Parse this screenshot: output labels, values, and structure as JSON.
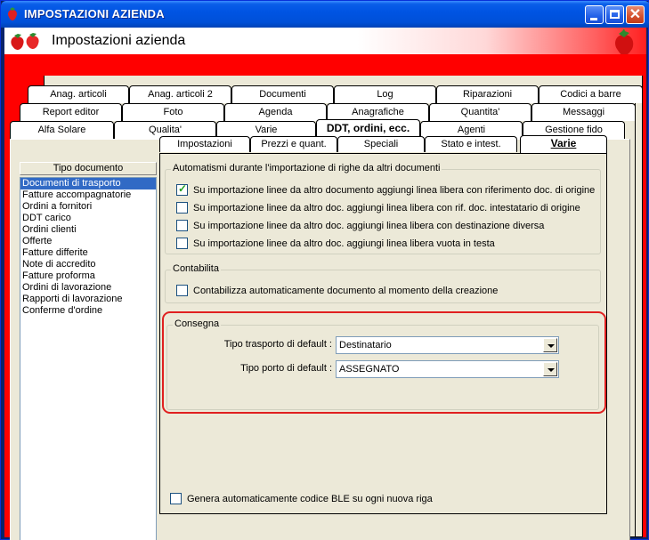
{
  "window": {
    "title": "IMPOSTAZIONI AZIENDA",
    "header_title": "Impostazioni azienda"
  },
  "tabs_row1": [
    "Anag. articoli",
    "Anag. articoli 2",
    "Documenti",
    "Log",
    "Riparazioni",
    "Codici a barre"
  ],
  "tabs_row2": [
    "Report editor",
    "Foto",
    "Agenda",
    "Anagrafiche",
    "Quantita'",
    "Messaggi"
  ],
  "tabs_row3": [
    "Alfa Solare",
    "Qualita'",
    "Varie",
    "DDT, ordini, ecc.",
    "Agenti",
    "Gestione fido"
  ],
  "doc_type_label": "Tipo documento",
  "doc_list": [
    "Documenti di trasporto",
    "Fatture accompagnatorie",
    "Ordini a fornitori",
    "DDT carico",
    "Ordini clienti",
    "Offerte",
    "Fatture differite",
    "Note di accredito",
    "Fatture proforma",
    "Ordini di lavorazione",
    "Rapporti di lavorazione",
    "Conferme d'ordine"
  ],
  "inner_tabs": [
    "Impostazioni",
    "Prezzi e quant.",
    "Speciali",
    "Stato e intest.",
    "Varie"
  ],
  "automatismi": {
    "title": "Automatismi durante l'importazione di righe da altri documenti",
    "items": [
      {
        "label": "Su importazione linee da altro documento aggiungi linea libera con riferimento doc. di origine",
        "checked": true
      },
      {
        "label": "Su importazione linee da altro doc. aggiungi linea libera con rif. doc. intestatario di origine",
        "checked": false
      },
      {
        "label": "Su importazione linee da altro doc. aggiungi linea libera con destinazione diversa",
        "checked": false
      },
      {
        "label": "Su importazione linee da altro doc. aggiungi linea libera vuota in testa",
        "checked": false
      }
    ]
  },
  "contabilita": {
    "title": "Contabilita",
    "item": "Contabilizza automaticamente documento al momento della creazione"
  },
  "consegna": {
    "title": "Consegna",
    "trasporto_label": "Tipo trasporto di default :",
    "trasporto_value": "Destinatario",
    "porto_label": "Tipo porto di default :",
    "porto_value": "ASSEGNATO"
  },
  "ble_label": "Genera automaticamente codice BLE su ogni nuova riga"
}
